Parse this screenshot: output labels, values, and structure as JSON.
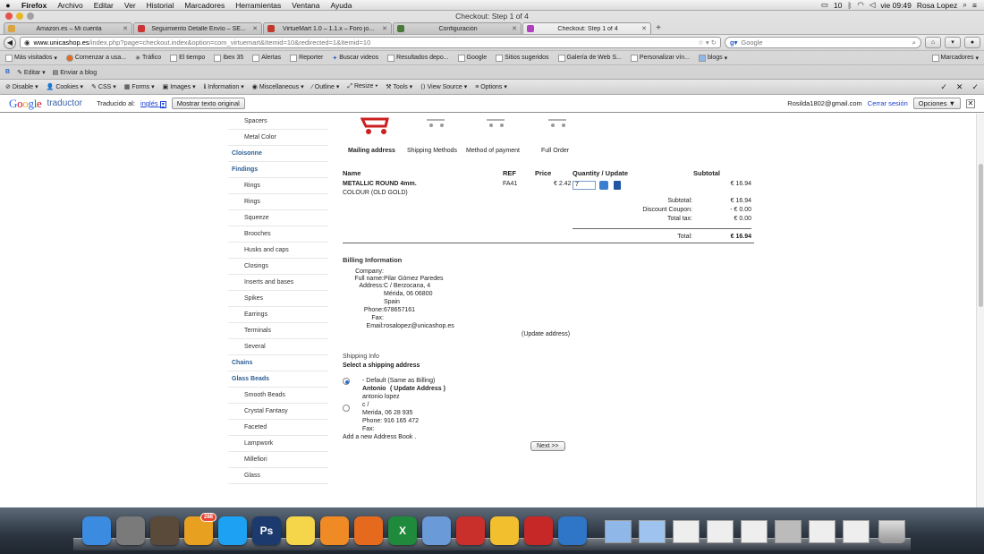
{
  "menubar": {
    "apple": "",
    "app": "Firefox",
    "items": [
      "Archivo",
      "Editar",
      "Ver",
      "Historial",
      "Marcadores",
      "Herramientas",
      "Ventana",
      "Ayuda"
    ],
    "status": {
      "battery_level": "10",
      "clock": "vie 09:49",
      "user": "Rosa Lopez"
    }
  },
  "window": {
    "title": "Checkout: Step 1 of 4"
  },
  "tabs": [
    {
      "label": "Amazon.es – Mi cuenta",
      "color": "#d9a441"
    },
    {
      "label": "Seguimiento Detalle Envío – SE...",
      "color": "#c33"
    },
    {
      "label": "VirtueMart 1.0 – 1.1.x – Foro jo...",
      "color": "#c0392b"
    },
    {
      "label": "Configuración",
      "color": "#4a7a3a"
    },
    {
      "label": "Checkout: Step 1 of 4",
      "color": "#b040c0",
      "active": true
    }
  ],
  "navbar": {
    "url_host": "www.unicashop.es",
    "url_path": "/index.php?page=checkout.index&option=com_virtuemart&Itemid=10&redirected=1&Itemid=10",
    "search_placeholder": "Google"
  },
  "bookmarks": [
    "Más visitados",
    "Comenzar a usa...",
    "Tráfico",
    "El tiempo",
    "Ibex 35",
    "Alertas",
    "Reporter",
    "Buscar videos",
    "Resultados depo...",
    "Google",
    "Sitios sugeridos",
    "Galería de Web S...",
    "Personalizar vín...",
    "blogs"
  ],
  "bookmarks_right": "Marcadores",
  "editbar": {
    "edit": "Editar",
    "send": "Enviar a blog"
  },
  "devbar": {
    "items": [
      "Disable",
      "Cookies",
      "CSS",
      "Forms",
      "Images",
      "Information",
      "Miscellaneous",
      "Outline",
      "Resize",
      "Tools",
      "View Source",
      "Options"
    ]
  },
  "google_translate": {
    "logo": "Google",
    "product": "traductor",
    "translated_to_label": "Traducido al:",
    "language": "inglés",
    "show_original": "Mostrar texto original",
    "email": "Rosilda1802@gmail.com",
    "signout": "Cerrar sesión",
    "options": "Opciones ▼"
  },
  "sidebar": [
    {
      "label": "Spacers",
      "type": "sub"
    },
    {
      "label": "Metal Color",
      "type": "sub"
    },
    {
      "label": "Cloisonne",
      "type": "cat"
    },
    {
      "label": "Findings",
      "type": "cat"
    },
    {
      "label": "Rings",
      "type": "sub"
    },
    {
      "label": "Rings",
      "type": "sub"
    },
    {
      "label": "Squeeze",
      "type": "sub"
    },
    {
      "label": "Brooches",
      "type": "sub"
    },
    {
      "label": "Husks and caps",
      "type": "sub"
    },
    {
      "label": "Closings",
      "type": "sub"
    },
    {
      "label": "Inserts and bases",
      "type": "sub"
    },
    {
      "label": "Spikes",
      "type": "sub"
    },
    {
      "label": "Earrings",
      "type": "sub"
    },
    {
      "label": "Terminals",
      "type": "sub"
    },
    {
      "label": "Several",
      "type": "sub"
    },
    {
      "label": "Chains",
      "type": "cat"
    },
    {
      "label": "Glass Beads",
      "type": "cat"
    },
    {
      "label": "Smooth Beads",
      "type": "sub"
    },
    {
      "label": "Crystal Fantasy",
      "type": "sub"
    },
    {
      "label": "Faceted",
      "type": "sub"
    },
    {
      "label": "Lampwork",
      "type": "sub"
    },
    {
      "label": "Millefiori",
      "type": "sub"
    },
    {
      "label": "Glass",
      "type": "sub"
    }
  ],
  "checkout": {
    "steps": [
      "Mailing address",
      "Shipping Methods",
      "Method of payment",
      "Full Order"
    ],
    "active_step": 0,
    "table_headers": {
      "name": "Name",
      "ref": "REF",
      "price": "Price",
      "qty": "Quantity / Update",
      "subtotal": "Subtotal"
    },
    "item": {
      "name": "METALLIC ROUND 4mm.",
      "variant": "COLOUR (OLD GOLD)",
      "ref": "FA41",
      "price": "€ 2.42",
      "qty": "7",
      "subtotal": "€ 16.94"
    },
    "summary": [
      {
        "label": "Subtotal:",
        "value": "€ 16.94"
      },
      {
        "label": "Discount Coupon:",
        "value": "- € 0.00"
      },
      {
        "label": "Total tax:",
        "value": "€ 0.00"
      }
    ],
    "total": {
      "label": "Total:",
      "value": "€ 16.94"
    },
    "billing": {
      "title": "Billing Information",
      "company_label": "Company:",
      "fullname_label": "Full name:",
      "fullname": "Pilar Gómez Paredes",
      "address_label": "Address:",
      "address1": "C / Berzocana, 4",
      "address2": "Mérida, 06 06800",
      "address3": "Spain",
      "phone_label": "Phone:",
      "phone": "678657161",
      "fax_label": "Fax:",
      "email_label": "Email:",
      "email": "rosalopez@unicashop.es",
      "update_link": "(Update address)"
    },
    "shipping": {
      "info": "Shipping Info",
      "select": "Select a shipping address",
      "default_option": "- Default (Same as Billing)",
      "alt_name": "Antonio",
      "alt_update": "( Update Address )",
      "alt_line1": "antonio lopez",
      "alt_line2": "c /",
      "alt_line3": "Merida, 06 28 935",
      "alt_phone": "Phone: 916 165 472",
      "alt_fax": "Fax:",
      "add_prefix": "Add a new",
      "add_link": "Address Book",
      "add_suffix": ".",
      "next": "Next >>"
    }
  },
  "dock": [
    {
      "icon": "finder-icon",
      "color": "#3b8be0"
    },
    {
      "icon": "launchpad-icon",
      "color": "#7a7a7a"
    },
    {
      "icon": "photo-icon",
      "color": "#5a4a3a"
    },
    {
      "icon": "o-app-icon",
      "color": "#e8a020",
      "badge": "288"
    },
    {
      "icon": "skype-icon",
      "color": "#1da1f2"
    },
    {
      "icon": "photoshop-icon",
      "color": "#1c3a6e",
      "text": "Ps"
    },
    {
      "icon": "stickies-icon",
      "color": "#f5d54a"
    },
    {
      "icon": "xampp-icon",
      "color": "#f08a24"
    },
    {
      "icon": "firefox-icon",
      "color": "#e66a1e"
    },
    {
      "icon": "excel-icon",
      "color": "#1f8a3b",
      "text": "X"
    },
    {
      "icon": "picasa-icon",
      "color": "#6a9ad8"
    },
    {
      "icon": "acrobat-icon",
      "color": "#c9302c"
    },
    {
      "icon": "chrome-icon",
      "color": "#f2c02e"
    },
    {
      "icon": "acrobat-pro-icon",
      "color": "#c62828"
    },
    {
      "icon": "itunes-icon",
      "color": "#2f75c8"
    }
  ],
  "colors": {
    "link": "#2b5e96",
    "accent": "#cc1f1f"
  }
}
